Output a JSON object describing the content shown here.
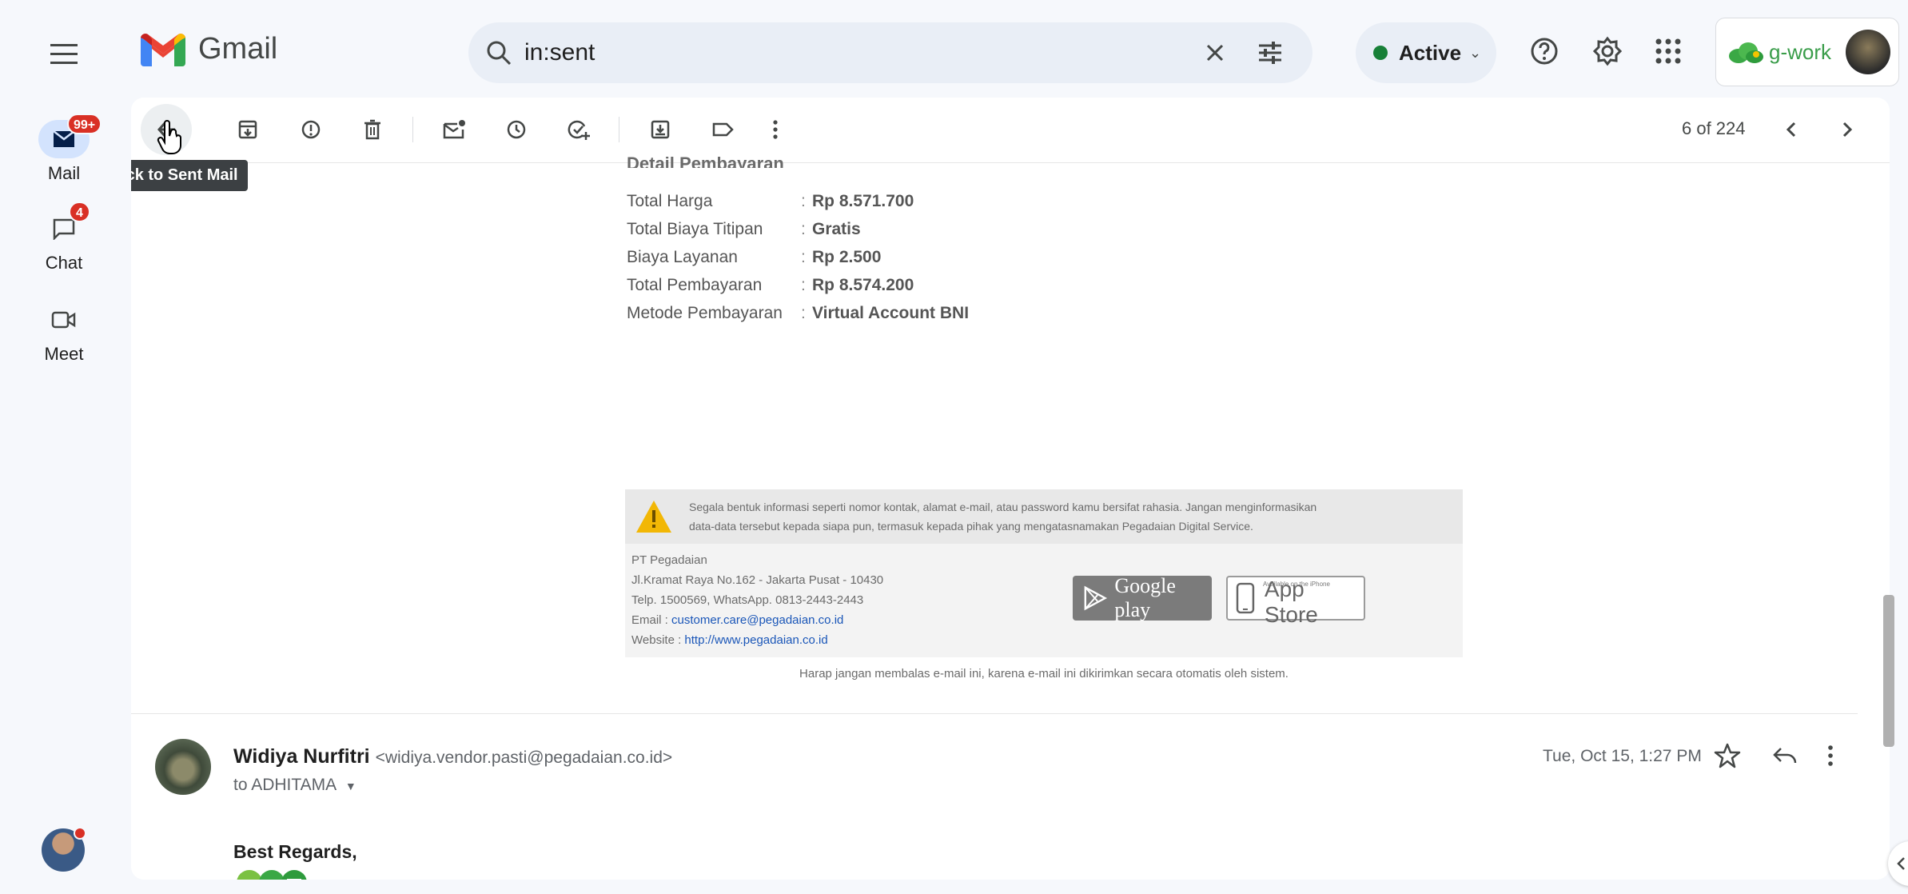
{
  "app": {
    "name": "Gmail"
  },
  "search": {
    "query": "in:sent"
  },
  "status": {
    "label": "Active",
    "color": "#188038"
  },
  "account": {
    "brand": "g-work"
  },
  "rail": {
    "mail": {
      "label": "Mail",
      "badge": "99+"
    },
    "chat": {
      "label": "Chat",
      "badge": "4"
    },
    "meet": {
      "label": "Meet"
    }
  },
  "toolbar": {
    "tooltip": "Back to Sent Mail",
    "pager": "6 of 224"
  },
  "email": {
    "section_title_cutoff": "Detail Pembayaran",
    "payment": [
      {
        "label": "Total Harga",
        "value": "Rp 8.571.700"
      },
      {
        "label": "Total Biaya Titipan",
        "value": "Gratis"
      },
      {
        "label": "Biaya Layanan",
        "value": "Rp 2.500"
      },
      {
        "label": "Total Pembayaran",
        "value": "Rp 8.574.200"
      },
      {
        "label": "Metode Pembayaran",
        "value": "Virtual Account BNI"
      }
    ],
    "warning_line1": "Segala bentuk informasi seperti nomor kontak, alamat e-mail, atau password kamu bersifat rahasia. Jangan menginformasikan",
    "warning_line2": "data-data tersebut kepada siapa pun, termasuk kepada pihak yang mengatasnamakan Pegadaian Digital Service.",
    "company": "PT Pegadaian",
    "address": "Jl.Kramat Raya No.162 - Jakarta Pusat - 10430",
    "phone": "Telp. 1500569, WhatsApp. 0813-2443-2443",
    "email_label": "Email : ",
    "email_value": "customer.care@pegadaian.co.id",
    "website_label": "Website : ",
    "website_value": "http://www.pegadaian.co.id",
    "google_play": "Google play",
    "app_store_small": "Available on the iPhone",
    "app_store": "App Store",
    "noreply": "Harap jangan membalas e-mail ini, karena e-mail ini dikirimkan secara otomatis oleh sistem."
  },
  "message": {
    "sender_name": "Widiya Nurfitri",
    "sender_email": "<widiya.vendor.pasti@pegadaian.co.id>",
    "to": "to ADHITAMA",
    "date": "Tue, Oct 15, 1:27 PM",
    "regards": "Best Regards,"
  }
}
